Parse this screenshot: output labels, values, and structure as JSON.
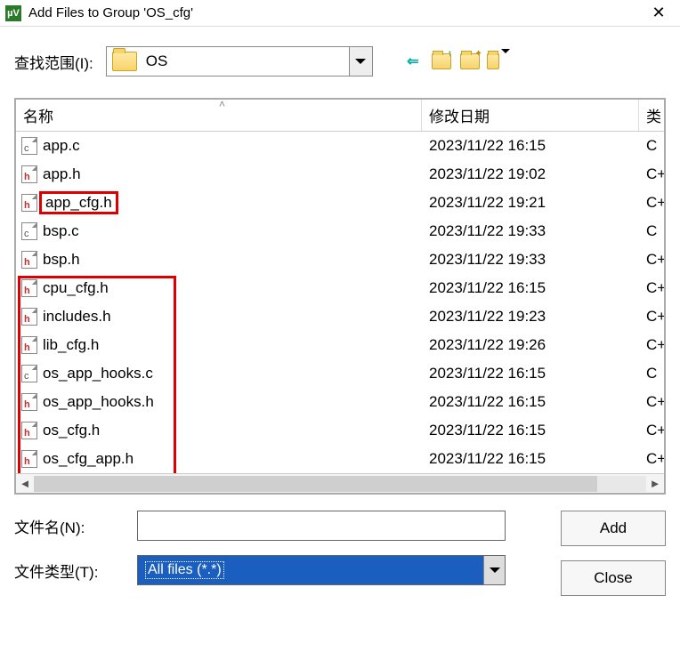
{
  "title": "Add Files to Group 'OS_cfg'",
  "lookin": {
    "label": "查找范围(I):",
    "folder": "OS"
  },
  "columns": {
    "name": "名称",
    "date": "修改日期",
    "type": "类"
  },
  "files": [
    {
      "name": "app.c",
      "date": "2023/11/22 16:15",
      "type": "C ",
      "icon": "c",
      "hi": false
    },
    {
      "name": "app.h",
      "date": "2023/11/22 19:02",
      "type": "C+",
      "icon": "h",
      "hi": false
    },
    {
      "name": "app_cfg.h",
      "date": "2023/11/22 19:21",
      "type": "C+",
      "icon": "h",
      "hi": true
    },
    {
      "name": "bsp.c",
      "date": "2023/11/22 19:33",
      "type": "C ",
      "icon": "c",
      "hi": false
    },
    {
      "name": "bsp.h",
      "date": "2023/11/22 19:33",
      "type": "C+",
      "icon": "h",
      "hi": false
    },
    {
      "name": "cpu_cfg.h",
      "date": "2023/11/22 16:15",
      "type": "C+",
      "icon": "h",
      "hi": false
    },
    {
      "name": "includes.h",
      "date": "2023/11/22 19:23",
      "type": "C+",
      "icon": "h",
      "hi": false
    },
    {
      "name": "lib_cfg.h",
      "date": "2023/11/22 19:26",
      "type": "C+",
      "icon": "h",
      "hi": false
    },
    {
      "name": "os_app_hooks.c",
      "date": "2023/11/22 16:15",
      "type": "C ",
      "icon": "c",
      "hi": false
    },
    {
      "name": "os_app_hooks.h",
      "date": "2023/11/22 16:15",
      "type": "C+",
      "icon": "h",
      "hi": false
    },
    {
      "name": "os_cfg.h",
      "date": "2023/11/22 16:15",
      "type": "C+",
      "icon": "h",
      "hi": false
    },
    {
      "name": "os_cfg_app.h",
      "date": "2023/11/22 16:15",
      "type": "C+",
      "icon": "h",
      "hi": false
    }
  ],
  "bottom": {
    "filename_label": "文件名(N):",
    "filetype_label": "文件类型(T):",
    "filetype_value": "All files (*.*)",
    "add_label": "Add",
    "close_label": "Close"
  }
}
